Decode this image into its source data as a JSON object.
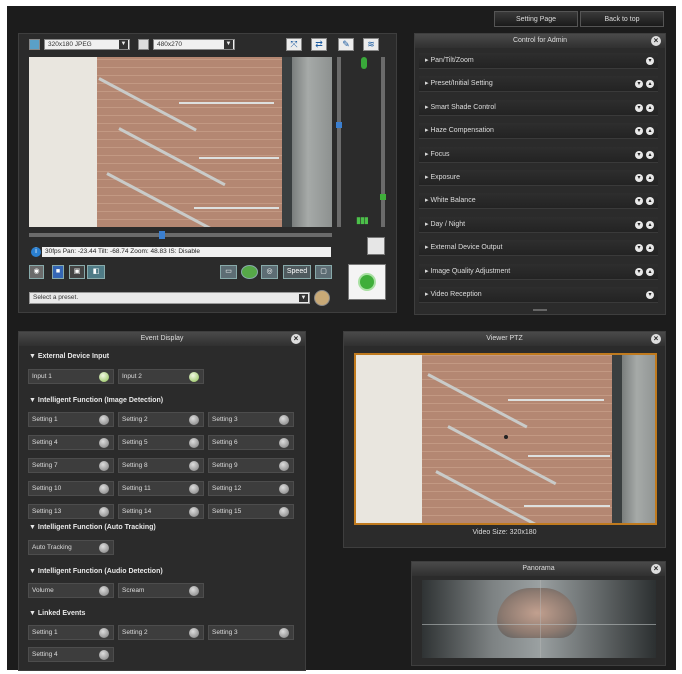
{
  "header": {
    "setting_page": "Setting Page",
    "back_to_top": "Back to top"
  },
  "live": {
    "resolution": "320x180 JPEG",
    "size": "480x270",
    "status": "30fps Pan: -23.44 Tilt: -68.74 Zoom: 48.83 IS: Disable",
    "preset_placeholder": "Select a preset.",
    "speed_label": "Speed"
  },
  "control_panel": {
    "title": "Control for Admin",
    "items": [
      {
        "label": "Pan/Tilt/Zoom",
        "icons": 1
      },
      {
        "label": "Preset/Initial Setting",
        "icons": 2
      },
      {
        "label": "Smart Shade Control",
        "icons": 2
      },
      {
        "label": "Haze Compensation",
        "icons": 2
      },
      {
        "label": "Focus",
        "icons": 2
      },
      {
        "label": "Exposure",
        "icons": 2
      },
      {
        "label": "White Balance",
        "icons": 2
      },
      {
        "label": "Day / Night",
        "icons": 2
      },
      {
        "label": "External Device Output",
        "icons": 2
      },
      {
        "label": "Image Quality Adjustment",
        "icons": 2
      },
      {
        "label": "Video Reception",
        "icons": 1
      }
    ]
  },
  "event_display": {
    "title": "Event Display",
    "ext_section": "External Device Input",
    "ext": [
      "Input 1",
      "Input 2"
    ],
    "img_section": "Intelligent Function (Image Detection)",
    "img": [
      "Setting 1",
      "Setting 2",
      "Setting 3",
      "Setting 4",
      "Setting 5",
      "Setting 6",
      "Setting 7",
      "Setting 8",
      "Setting 9",
      "Setting 10",
      "Setting 11",
      "Setting 12",
      "Setting 13",
      "Setting 14",
      "Setting 15"
    ],
    "track_section": "Intelligent Function (Auto Tracking)",
    "track": [
      "Auto Tracking"
    ],
    "audio_section": "Intelligent Function (Audio Detection)",
    "audio": [
      "Volume",
      "Scream"
    ],
    "linked_section": "Linked Events",
    "linked": [
      "Setting 1",
      "Setting 2",
      "Setting 3",
      "Setting 4"
    ]
  },
  "viewer": {
    "title": "Viewer PTZ",
    "video_size": "Video Size: 320x180"
  },
  "panorama": {
    "title": "Panorama"
  },
  "colors": {
    "accent": "#c07a1e",
    "panel": "#2b2b2b",
    "green": "#3aa82e"
  }
}
